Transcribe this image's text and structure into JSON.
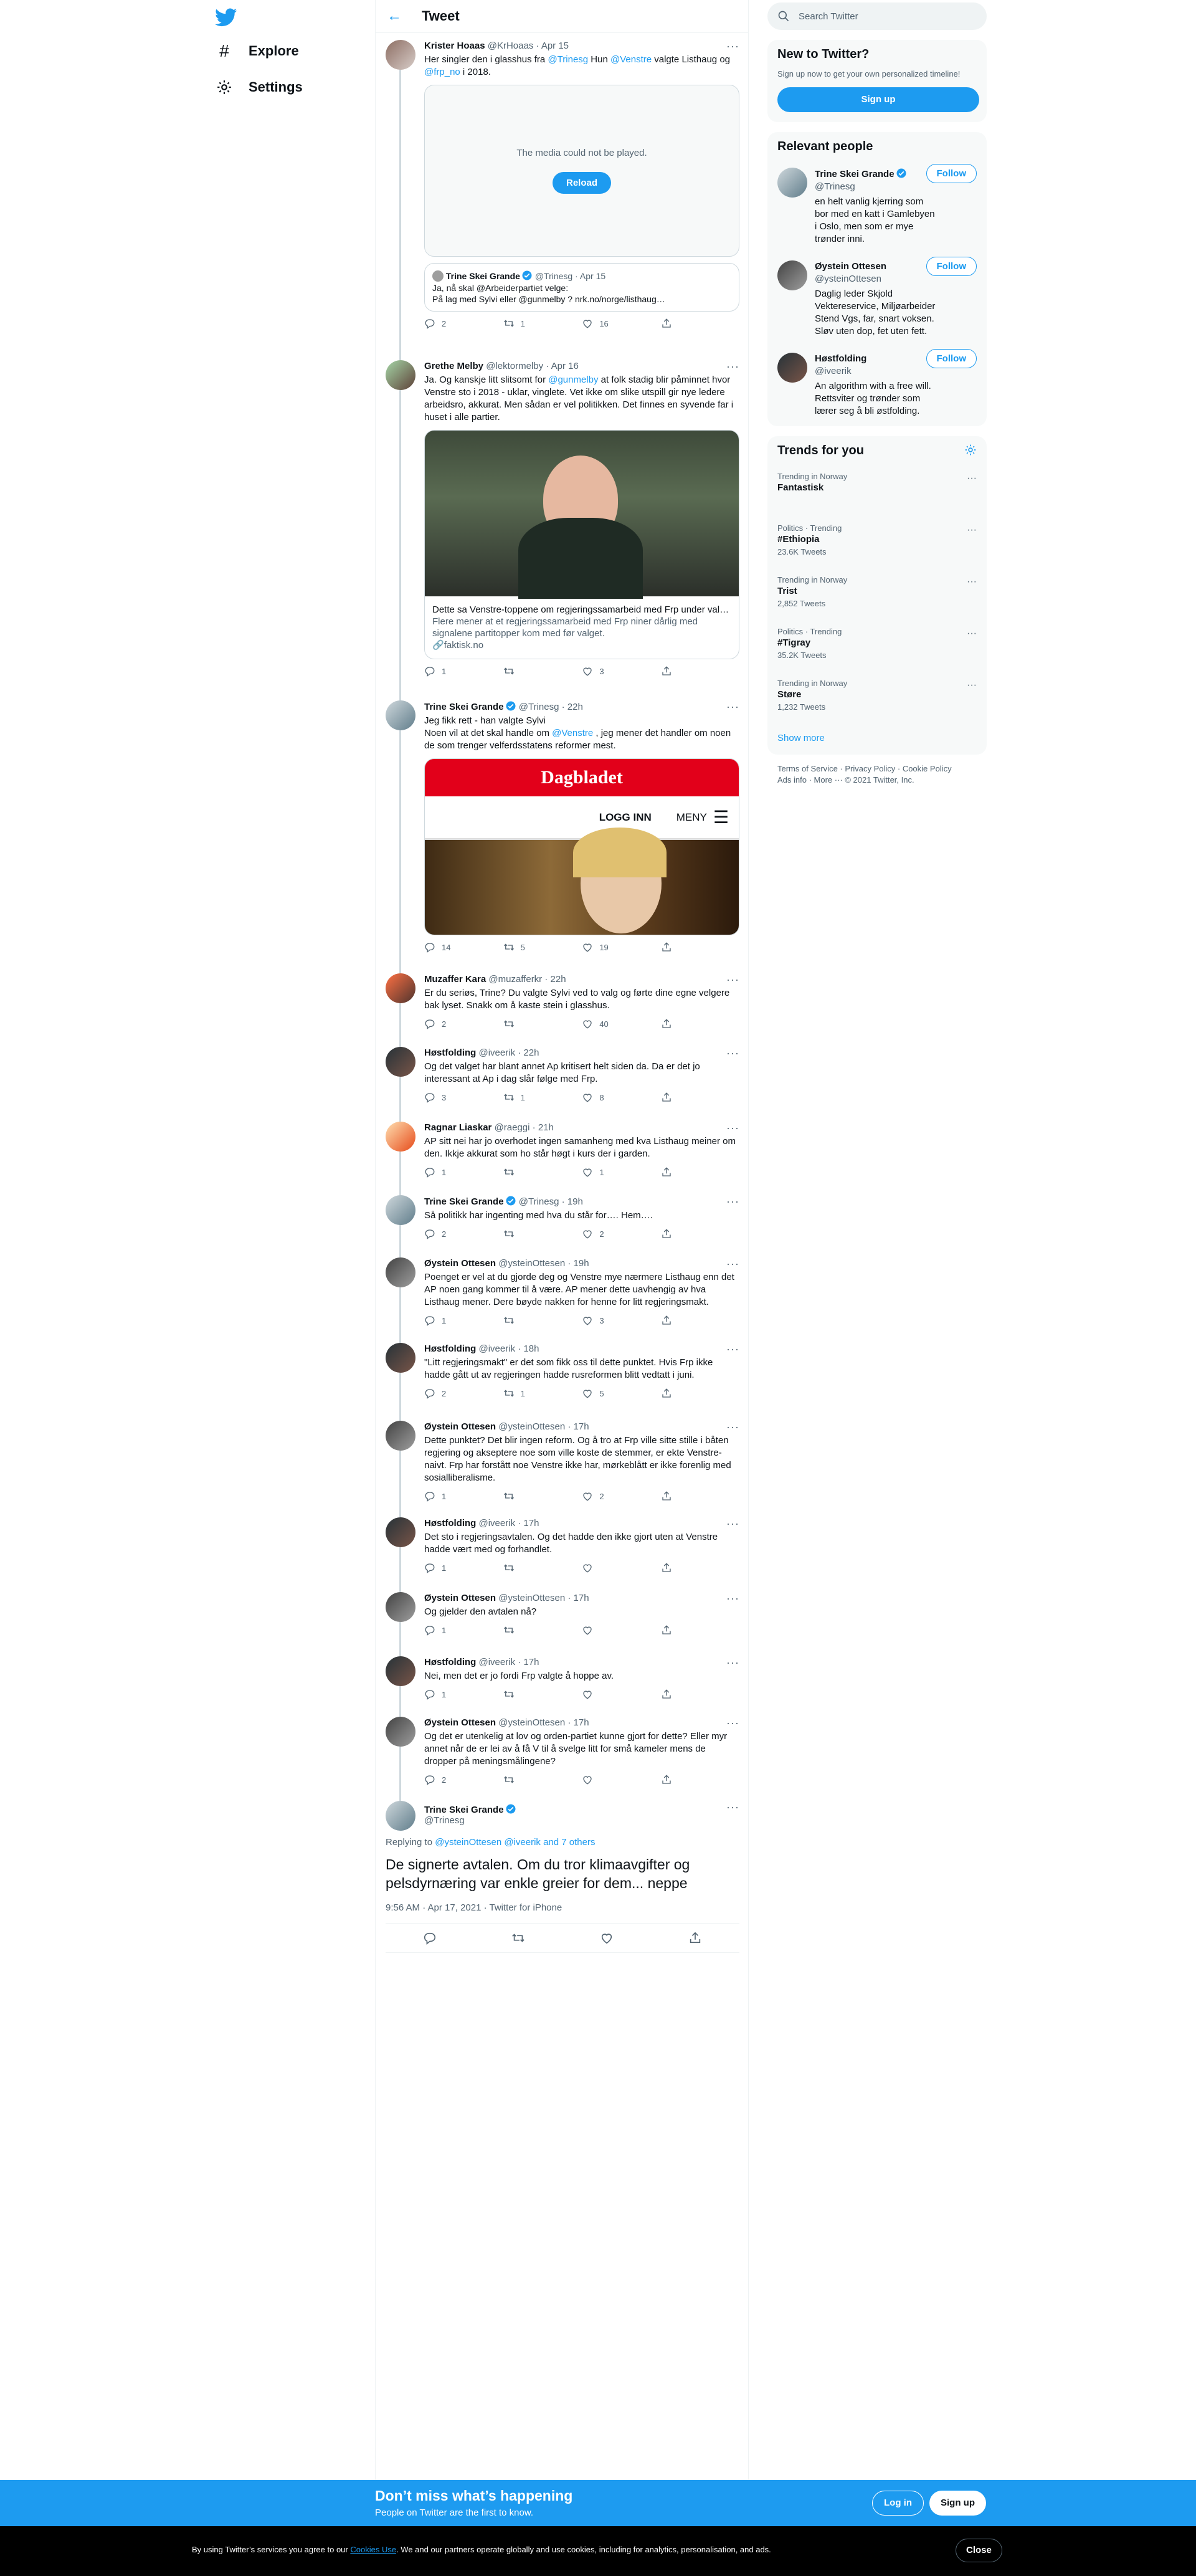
{
  "nav": {
    "explore": "Explore",
    "settings": "Settings"
  },
  "header": {
    "title": "Tweet"
  },
  "tweets": [
    {
      "name": "Krister Hoaas",
      "handle": "@KrHoaas",
      "time": "Apr 15",
      "text_parts": [
        "Her singler den i glasshus fra ",
        "@Trinesg",
        " Hun ",
        "@Venstre",
        " valgte Listhaug og ",
        "@frp_no",
        " i 2018."
      ],
      "media_error": "The media could not be played.",
      "reload": "Reload",
      "quote": {
        "name": "Trine Skei Grande",
        "handle": "@Trinesg",
        "time": "Apr 15",
        "line1": "Ja, nå skal @Arbeiderpartiet velge:",
        "line2": "På lag med Sylvi eller @gunmelby ?  nrk.no/norge/listhaug…"
      },
      "replies": "2",
      "retweets": "1",
      "likes": "16"
    },
    {
      "name": "Grethe Melby",
      "handle": "@lektormelby",
      "time": "Apr 16",
      "text_parts": [
        "Ja. Og kanskje litt slitsomt for ",
        "@gunmelby",
        " at folk stadig blir påminnet hvor Venstre sto i 2018 - uklar, vinglete. Vet ikke om slike utspill gir nye ledere arbeidsro, akkurat. Men sådan er vel politikken. Det finnes en syvende far i huset i alle partier."
      ],
      "card_title": "Dette sa Venstre-toppene om regjeringssamarbeid med Frp under val…",
      "card_desc": "Flere mener at et regjeringssamarbeid med Frp niner dårlig med signalene partitopper kom med før valget.",
      "card_domain": "faktisk.no",
      "replies": "1",
      "retweets": "",
      "likes": "3"
    },
    {
      "name": "Trine Skei Grande",
      "handle": "@Trinesg",
      "time": "22h",
      "text_parts": [
        "Jeg fikk rett - han valgte Sylvi\nNoen vil at det skal handle om ",
        "@Venstre",
        " , jeg mener det handler om noen de som trenger velferdsstatens reformer mest."
      ],
      "dagbladet": {
        "brand": "Dagbladet",
        "login": "LOGG INN",
        "menu": "MENY"
      },
      "replies": "14",
      "retweets": "5",
      "likes": "19"
    },
    {
      "name": "Muzaffer Kara",
      "handle": "@muzafferkr",
      "time": "22h",
      "text": "Er du seriøs, Trine? Du valgte Sylvi ved to valg og førte dine egne velgere bak lyset. Snakk om å kaste stein i glasshus.",
      "replies": "2",
      "retweets": "",
      "likes": "40"
    },
    {
      "name": "Høstfolding",
      "handle": "@iveerik",
      "time": "22h",
      "text": "Og det valget har blant annet Ap kritisert helt siden da. Da er det jo interessant at Ap i dag slår følge med Frp.",
      "replies": "3",
      "retweets": "1",
      "likes": "8"
    },
    {
      "name": "Ragnar Liaskar",
      "handle": "@raeggi",
      "time": "21h",
      "text": "AP sitt nei har jo overhodet ingen samanheng med kva Listhaug meiner om den. Ikkje akkurat som ho står høgt i kurs der i garden.",
      "replies": "1",
      "retweets": "",
      "likes": "1"
    },
    {
      "name": "Trine Skei Grande",
      "handle": "@Trinesg",
      "time": "19h",
      "text": "Så politikk har ingenting med hva du står for…. Hem….",
      "replies": "2",
      "retweets": "",
      "likes": "2",
      "verified": true
    },
    {
      "name": "Øystein Ottesen",
      "handle": "@ysteinOttesen",
      "time": "19h",
      "text": "Poenget er vel at du gjorde deg og Venstre mye nærmere Listhaug enn det AP noen gang kommer til å være. AP mener dette uavhengig av hva Listhaug mener. Dere bøyde nakken for henne for litt regjeringsmakt.",
      "replies": "1",
      "retweets": "",
      "likes": "3"
    },
    {
      "name": "Høstfolding",
      "handle": "@iveerik",
      "time": "18h",
      "text": "\"Litt regjeringsmakt\" er det som fikk oss til dette punktet. Hvis Frp ikke hadde gått ut av regjeringen hadde rusreformen blitt vedtatt i juni.",
      "replies": "2",
      "retweets": "1",
      "likes": "5"
    },
    {
      "name": "Øystein Ottesen",
      "handle": "@ysteinOttesen",
      "time": "17h",
      "text": "Dette punktet? Det blir ingen reform. Og å tro at Frp ville sitte stille i båten regjering og akseptere noe som ville koste de stemmer, er ekte Venstre-naivt. Frp har forstått noe Venstre ikke har, mørkeblått er ikke forenlig med sosialliberalisme.",
      "replies": "1",
      "retweets": "",
      "likes": "2"
    },
    {
      "name": "Høstfolding",
      "handle": "@iveerik",
      "time": "17h",
      "text": "Det sto i regjeringsavtalen. Og det hadde den ikke gjort uten at Venstre hadde vært med og forhandlet.",
      "replies": "1",
      "retweets": "",
      "likes": ""
    },
    {
      "name": "Øystein Ottesen",
      "handle": "@ysteinOttesen",
      "time": "17h",
      "text": "Og gjelder den avtalen nå?",
      "replies": "1",
      "retweets": "",
      "likes": ""
    },
    {
      "name": "Høstfolding",
      "handle": "@iveerik",
      "time": "17h",
      "text": "Nei, men det er jo fordi Frp valgte å hoppe av.",
      "replies": "1",
      "retweets": "",
      "likes": ""
    },
    {
      "name": "Øystein Ottesen",
      "handle": "@ysteinOttesen",
      "time": "17h",
      "text": "Og det er utenkelig at lov og orden-partiet kunne gjort for dette? Eller myr annet når de er lei av å få V til å svelge litt for små kameler mens de dropper på meningsmålingene?",
      "replies": "2",
      "retweets": "",
      "likes": ""
    }
  ],
  "main_tweet": {
    "name": "Trine Skei Grande",
    "handle": "@Trinesg",
    "replying_prefix": "Replying to ",
    "replying_to": "@ysteinOttesen @iveerik and 7 others",
    "text": "De signerte avtalen. Om du tror klimaavgifter og pelsdyrnæring var enkle greier for dem... neppe",
    "meta": "9:56 AM · Apr 17, 2021 · Twitter for iPhone"
  },
  "sidebar": {
    "search_placeholder": "Search Twitter",
    "new_title": "New to Twitter?",
    "new_sub": "Sign up now to get your own personalized timeline!",
    "signup": "Sign up",
    "relevant_title": "Relevant people",
    "follow": "Follow",
    "people": [
      {
        "name": "Trine Skei Grande",
        "handle": "@Trinesg",
        "bio": "en helt vanlig kjerring som bor med en katt i Gamlebyen i Oslo, men som er mye trønder inni."
      },
      {
        "name": "Øystein Ottesen",
        "handle": "@ysteinOttesen",
        "bio": "Daglig leder Skjold Vektereservice, Miljøarbeider Stend Vgs, far, snart voksen. Sløv uten dop, fet uten fett."
      },
      {
        "name": "Høstfolding",
        "handle": "@iveerik",
        "bio": "An algorithm with a free will. Rettsviter og trønder som lærer seg å bli østfolding."
      }
    ],
    "trends_title": "Trends for you",
    "trends": [
      {
        "ctx": "Trending in Norway",
        "name": "Fantastisk",
        "count": ""
      },
      {
        "ctx": "Politics · Trending",
        "name": "#Ethiopia",
        "count": "23.6K Tweets"
      },
      {
        "ctx": "Trending in Norway",
        "name": "Trist",
        "count": "2,852 Tweets"
      },
      {
        "ctx": "Politics · Trending",
        "name": "#Tigray",
        "count": "35.2K Tweets"
      },
      {
        "ctx": "Trending in Norway",
        "name": "Støre",
        "count": "1,232 Tweets"
      }
    ],
    "show_more": "Show more",
    "footer1": "Terms of Service · Privacy Policy · Cookie Policy",
    "footer2": "Ads info · More ··· © 2021 Twitter, Inc."
  },
  "bottom": {
    "title": "Don’t miss what’s happening",
    "sub": "People on Twitter are the first to know.",
    "login": "Log in",
    "signup": "Sign up"
  },
  "cookie": {
    "prefix": "By using Twitter’s services you agree to our ",
    "link": "Cookies Use",
    "suffix": ". We and our partners operate globally and use cookies, including for analytics, personalisation, and ads.",
    "close": "Close"
  },
  "colors": {
    "accent": "#1d9bf0",
    "text": "#0f1419",
    "muted": "#536471"
  }
}
